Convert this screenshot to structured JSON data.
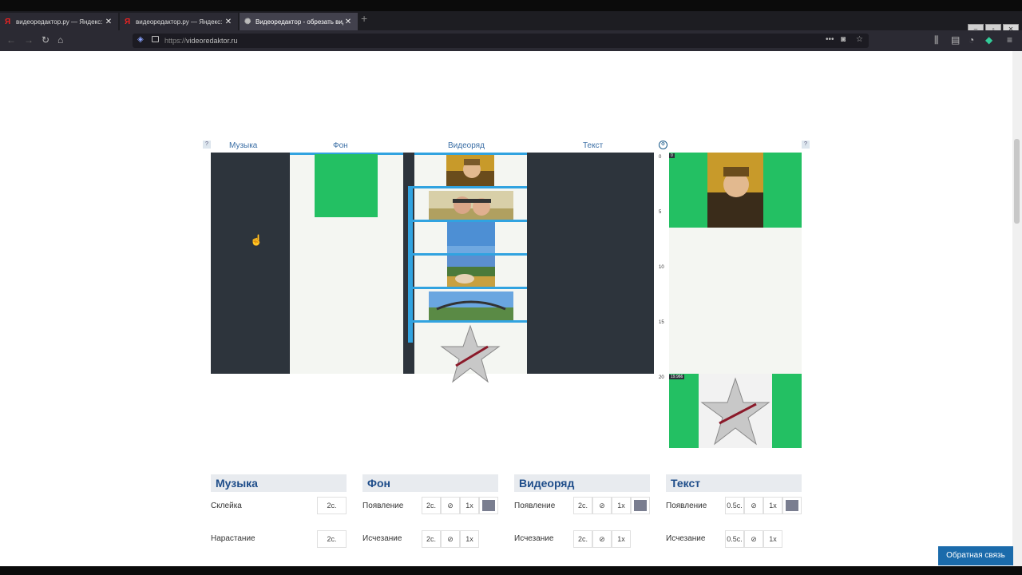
{
  "browser": {
    "tabs": [
      {
        "title": "видеоредактор.ру — Яндекс: н",
        "favicon": "Я",
        "active": false
      },
      {
        "title": "видеоредактор.ру — Яндекс: н",
        "favicon": "Я",
        "active": false
      },
      {
        "title": "Видеоредактор - обрезать вид",
        "favicon": "globe",
        "active": true
      }
    ],
    "url_prefix": "https://",
    "url_host": "videoredaktor.ru"
  },
  "editor": {
    "columns": {
      "music": "Музыка",
      "background": "Фон",
      "videotrack": "Видеоряд",
      "text": "Текст"
    },
    "help_label": "?",
    "timeline_ticks": [
      "0",
      "5",
      "10",
      "15",
      "20"
    ],
    "preview_start": "0",
    "preview_end": "19.966"
  },
  "panels": {
    "music": {
      "title": "Музыка",
      "rows": [
        {
          "label": "Склейка",
          "value": "2с."
        },
        {
          "label": "Нарастание",
          "value": "2с."
        }
      ]
    },
    "background": {
      "title": "Фон",
      "rows": [
        {
          "label": "Появление",
          "duration": "2с.",
          "speed": "1x"
        },
        {
          "label": "Исчезание",
          "duration": "2с.",
          "speed": "1x"
        }
      ]
    },
    "videotrack": {
      "title": "Видеоряд",
      "rows": [
        {
          "label": "Появление",
          "duration": "2с.",
          "speed": "1x"
        },
        {
          "label": "Исчезание",
          "duration": "2с.",
          "speed": "1x"
        }
      ]
    },
    "text": {
      "title": "Текст",
      "rows": [
        {
          "label": "Появление",
          "duration": "0.5с.",
          "speed": "1x"
        },
        {
          "label": "Исчезание",
          "duration": "0.5с.",
          "speed": "1x"
        }
      ]
    }
  },
  "feedback_button": "Обратная связь",
  "colors": {
    "accent_blue": "#31a3e0",
    "dark_lane": "#2d343c",
    "green": "#23c063",
    "title_blue": "#1e4d8a"
  }
}
